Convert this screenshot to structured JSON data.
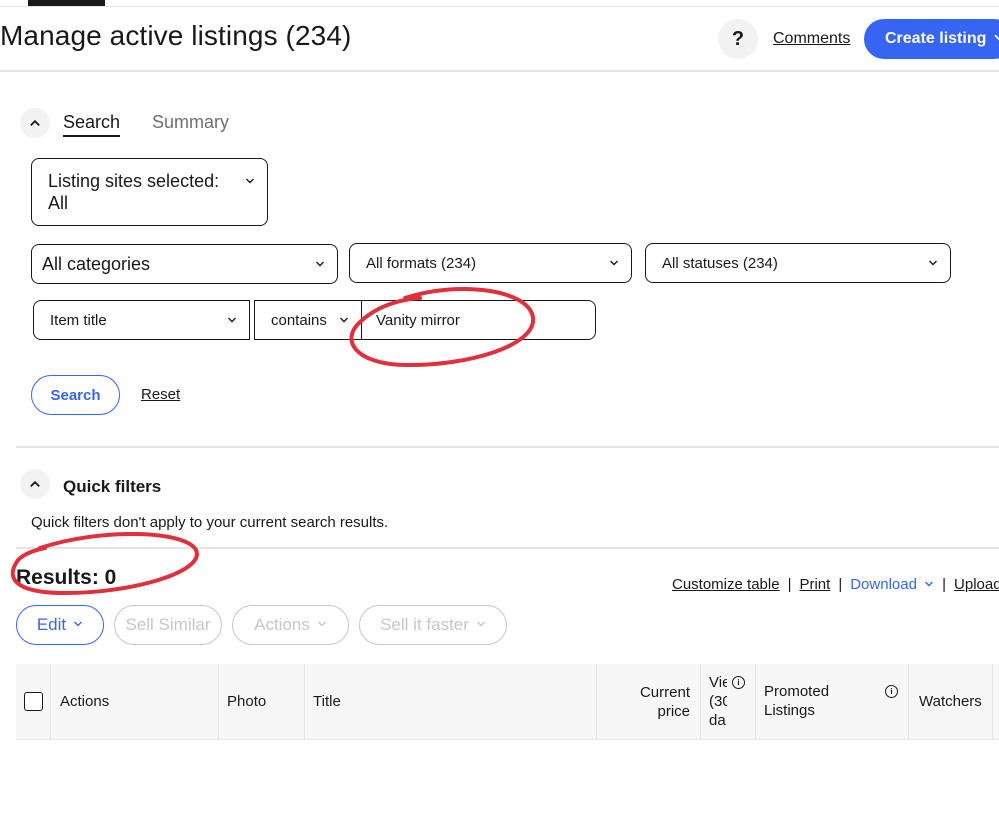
{
  "header": {
    "title": "Manage active listings (234)",
    "help_label": "?",
    "comments_label": "Comments",
    "create_listing_label": "Create listing"
  },
  "search_section": {
    "tabs": [
      {
        "label": "Search",
        "active": true
      },
      {
        "label": "Summary",
        "active": false
      }
    ],
    "listing_sites": {
      "label": "Listing sites selected:",
      "value": "All"
    },
    "categories": {
      "value": "All categories"
    },
    "formats": {
      "value": "All formats (234)"
    },
    "statuses": {
      "value": "All statuses (234)"
    },
    "field": {
      "value": "Item title"
    },
    "operator": {
      "value": "contains"
    },
    "query": {
      "value": "Vanity mirror"
    },
    "search_button": "Search",
    "reset_link": "Reset"
  },
  "quick_filters": {
    "title": "Quick filters",
    "note": "Quick filters don't apply to your current search results."
  },
  "results": {
    "label": "Results: 0",
    "toolbar": {
      "customize": "Customize table",
      "print": "Print",
      "download": "Download",
      "upload": "Upload",
      "separator": "|"
    },
    "actions": {
      "edit": "Edit",
      "sell_similar": "Sell Similar",
      "actions": "Actions",
      "sell_it_faster": "Sell it faster"
    }
  },
  "table": {
    "columns": {
      "actions": "Actions",
      "photo": "Photo",
      "title": "Title",
      "current_price_1": "Current",
      "current_price_2": "price",
      "views_1": "Vie",
      "views_2": "(30",
      "views_3": "da",
      "promoted_1": "Promoted",
      "promoted_2": "Listings",
      "watchers": "Watchers"
    }
  },
  "colors": {
    "accent": "#3665f3",
    "annotation": "#e0303c",
    "text": "#191919",
    "muted": "#707070"
  }
}
